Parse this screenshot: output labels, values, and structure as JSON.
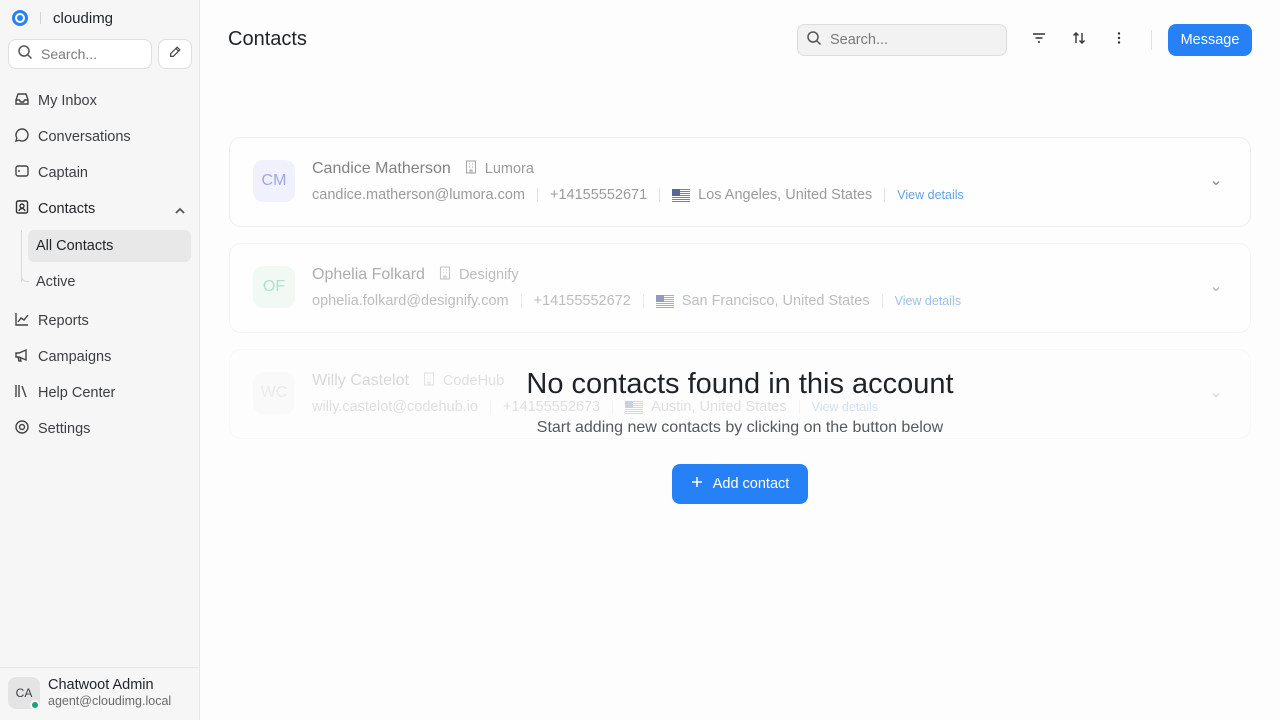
{
  "sidebar": {
    "brand": "cloudimg",
    "search_placeholder": "Search...",
    "items": [
      {
        "label": "My Inbox",
        "icon": "inbox-icon"
      },
      {
        "label": "Conversations",
        "icon": "chat-bubble-icon"
      },
      {
        "label": "Captain",
        "icon": "captain-icon"
      },
      {
        "label": "Contacts",
        "icon": "contacts-icon"
      },
      {
        "label": "Reports",
        "icon": "chart-line-icon"
      },
      {
        "label": "Campaigns",
        "icon": "megaphone-icon"
      },
      {
        "label": "Help Center",
        "icon": "library-icon"
      },
      {
        "label": "Settings",
        "icon": "settings-icon"
      }
    ],
    "contacts_sub": [
      {
        "label": "All Contacts",
        "active": true
      },
      {
        "label": "Active",
        "active": false
      }
    ],
    "profile": {
      "initials": "CA",
      "name": "Chatwoot Admin",
      "email": "agent@cloudimg.local",
      "status_color": "#1aa37a"
    }
  },
  "header": {
    "title": "Contacts",
    "search_placeholder": "Search...",
    "message_label": "Message"
  },
  "contacts": [
    {
      "initials": "CM",
      "name": "Candice Matherson",
      "company": "Lumora",
      "email": "candice.matherson@lumora.com",
      "phone": "+14155552671",
      "location": "Los Angeles, United States",
      "view": "View details",
      "avatar_bg": "#eef0fe",
      "avatar_color": "#8e9bd8"
    },
    {
      "initials": "OF",
      "name": "Ophelia Folkard",
      "company": "Designify",
      "email": "ophelia.folkard@designify.com",
      "phone": "+14155552672",
      "location": "San Francisco, United States",
      "view": "View details",
      "avatar_bg": "#e8f6ef",
      "avatar_color": "#7cc7a3"
    },
    {
      "initials": "WC",
      "name": "Willy Castelot",
      "company": "CodeHub",
      "email": "willy.castelot@codehub.io",
      "phone": "+14155552673",
      "location": "Austin, United States",
      "view": "View details",
      "avatar_bg": "#f1f1f1",
      "avatar_color": "#b4b4b4"
    }
  ],
  "empty_state": {
    "title": "No contacts found in this account",
    "subtitle": "Start adding new contacts by clicking on the button below",
    "button": "Add contact"
  },
  "colors": {
    "accent": "#2781f6"
  }
}
